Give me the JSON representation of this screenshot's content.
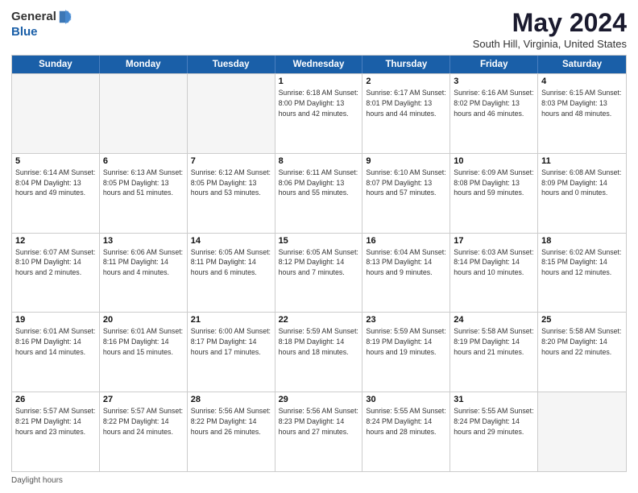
{
  "header": {
    "logo_general": "General",
    "logo_blue": "Blue",
    "month_title": "May 2024",
    "location": "South Hill, Virginia, United States"
  },
  "calendar": {
    "days_of_week": [
      "Sunday",
      "Monday",
      "Tuesday",
      "Wednesday",
      "Thursday",
      "Friday",
      "Saturday"
    ],
    "weeks": [
      [
        {
          "day": "",
          "info": "",
          "empty": true
        },
        {
          "day": "",
          "info": "",
          "empty": true
        },
        {
          "day": "",
          "info": "",
          "empty": true
        },
        {
          "day": "1",
          "info": "Sunrise: 6:18 AM\nSunset: 8:00 PM\nDaylight: 13 hours\nand 42 minutes."
        },
        {
          "day": "2",
          "info": "Sunrise: 6:17 AM\nSunset: 8:01 PM\nDaylight: 13 hours\nand 44 minutes."
        },
        {
          "day": "3",
          "info": "Sunrise: 6:16 AM\nSunset: 8:02 PM\nDaylight: 13 hours\nand 46 minutes."
        },
        {
          "day": "4",
          "info": "Sunrise: 6:15 AM\nSunset: 8:03 PM\nDaylight: 13 hours\nand 48 minutes."
        }
      ],
      [
        {
          "day": "5",
          "info": "Sunrise: 6:14 AM\nSunset: 8:04 PM\nDaylight: 13 hours\nand 49 minutes."
        },
        {
          "day": "6",
          "info": "Sunrise: 6:13 AM\nSunset: 8:05 PM\nDaylight: 13 hours\nand 51 minutes."
        },
        {
          "day": "7",
          "info": "Sunrise: 6:12 AM\nSunset: 8:05 PM\nDaylight: 13 hours\nand 53 minutes."
        },
        {
          "day": "8",
          "info": "Sunrise: 6:11 AM\nSunset: 8:06 PM\nDaylight: 13 hours\nand 55 minutes."
        },
        {
          "day": "9",
          "info": "Sunrise: 6:10 AM\nSunset: 8:07 PM\nDaylight: 13 hours\nand 57 minutes."
        },
        {
          "day": "10",
          "info": "Sunrise: 6:09 AM\nSunset: 8:08 PM\nDaylight: 13 hours\nand 59 minutes."
        },
        {
          "day": "11",
          "info": "Sunrise: 6:08 AM\nSunset: 8:09 PM\nDaylight: 14 hours\nand 0 minutes."
        }
      ],
      [
        {
          "day": "12",
          "info": "Sunrise: 6:07 AM\nSunset: 8:10 PM\nDaylight: 14 hours\nand 2 minutes."
        },
        {
          "day": "13",
          "info": "Sunrise: 6:06 AM\nSunset: 8:11 PM\nDaylight: 14 hours\nand 4 minutes."
        },
        {
          "day": "14",
          "info": "Sunrise: 6:05 AM\nSunset: 8:11 PM\nDaylight: 14 hours\nand 6 minutes."
        },
        {
          "day": "15",
          "info": "Sunrise: 6:05 AM\nSunset: 8:12 PM\nDaylight: 14 hours\nand 7 minutes."
        },
        {
          "day": "16",
          "info": "Sunrise: 6:04 AM\nSunset: 8:13 PM\nDaylight: 14 hours\nand 9 minutes."
        },
        {
          "day": "17",
          "info": "Sunrise: 6:03 AM\nSunset: 8:14 PM\nDaylight: 14 hours\nand 10 minutes."
        },
        {
          "day": "18",
          "info": "Sunrise: 6:02 AM\nSunset: 8:15 PM\nDaylight: 14 hours\nand 12 minutes."
        }
      ],
      [
        {
          "day": "19",
          "info": "Sunrise: 6:01 AM\nSunset: 8:16 PM\nDaylight: 14 hours\nand 14 minutes."
        },
        {
          "day": "20",
          "info": "Sunrise: 6:01 AM\nSunset: 8:16 PM\nDaylight: 14 hours\nand 15 minutes."
        },
        {
          "day": "21",
          "info": "Sunrise: 6:00 AM\nSunset: 8:17 PM\nDaylight: 14 hours\nand 17 minutes."
        },
        {
          "day": "22",
          "info": "Sunrise: 5:59 AM\nSunset: 8:18 PM\nDaylight: 14 hours\nand 18 minutes."
        },
        {
          "day": "23",
          "info": "Sunrise: 5:59 AM\nSunset: 8:19 PM\nDaylight: 14 hours\nand 19 minutes."
        },
        {
          "day": "24",
          "info": "Sunrise: 5:58 AM\nSunset: 8:19 PM\nDaylight: 14 hours\nand 21 minutes."
        },
        {
          "day": "25",
          "info": "Sunrise: 5:58 AM\nSunset: 8:20 PM\nDaylight: 14 hours\nand 22 minutes."
        }
      ],
      [
        {
          "day": "26",
          "info": "Sunrise: 5:57 AM\nSunset: 8:21 PM\nDaylight: 14 hours\nand 23 minutes."
        },
        {
          "day": "27",
          "info": "Sunrise: 5:57 AM\nSunset: 8:22 PM\nDaylight: 14 hours\nand 24 minutes."
        },
        {
          "day": "28",
          "info": "Sunrise: 5:56 AM\nSunset: 8:22 PM\nDaylight: 14 hours\nand 26 minutes."
        },
        {
          "day": "29",
          "info": "Sunrise: 5:56 AM\nSunset: 8:23 PM\nDaylight: 14 hours\nand 27 minutes."
        },
        {
          "day": "30",
          "info": "Sunrise: 5:55 AM\nSunset: 8:24 PM\nDaylight: 14 hours\nand 28 minutes."
        },
        {
          "day": "31",
          "info": "Sunrise: 5:55 AM\nSunset: 8:24 PM\nDaylight: 14 hours\nand 29 minutes."
        },
        {
          "day": "",
          "info": "",
          "empty": true
        }
      ]
    ]
  },
  "footer": {
    "text": "Daylight hours"
  }
}
